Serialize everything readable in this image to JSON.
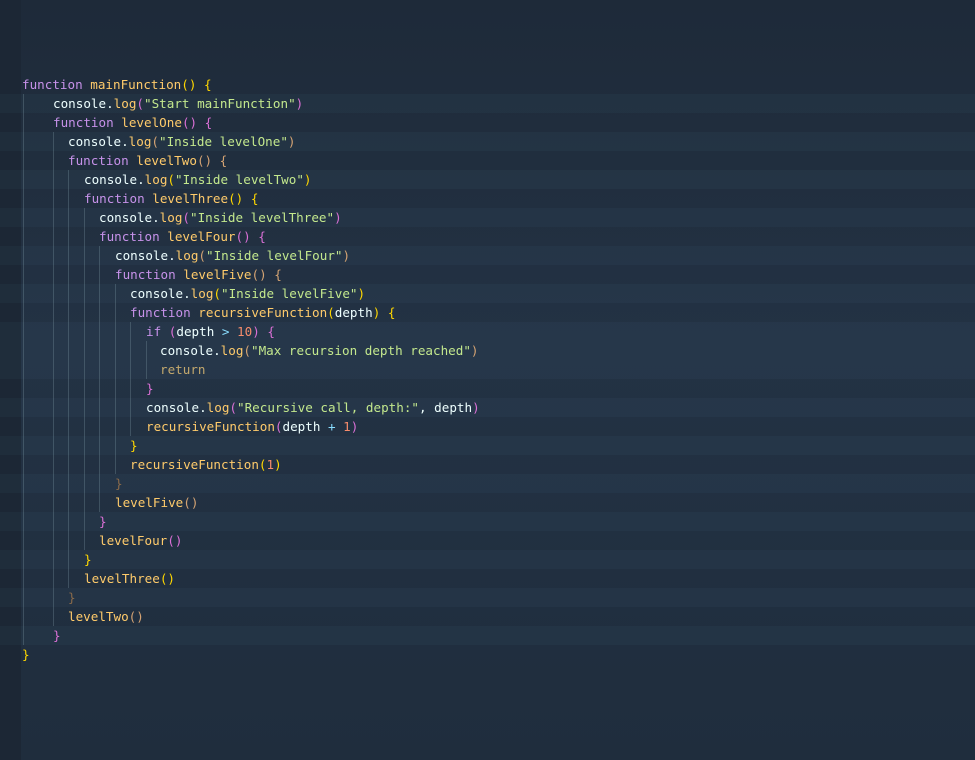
{
  "editor": {
    "lines": [
      [
        {
          "t": "function",
          "c": "kw"
        },
        {
          "t": " ",
          "c": "id"
        },
        {
          "t": "mainFunction",
          "c": "fn"
        },
        {
          "t": "() {",
          "c": "p1"
        }
      ],
      [
        {
          "t": "console",
          "c": "id"
        },
        {
          "t": ".",
          "c": "id"
        },
        {
          "t": "log",
          "c": "fn"
        },
        {
          "t": "(",
          "c": "p2"
        },
        {
          "t": "\"Start mainFunction\"",
          "c": "str"
        },
        {
          "t": ")",
          "c": "p2"
        }
      ],
      [
        {
          "t": "function",
          "c": "kw"
        },
        {
          "t": " ",
          "c": "id"
        },
        {
          "t": "levelOne",
          "c": "fn"
        },
        {
          "t": "() {",
          "c": "p2"
        }
      ],
      [
        {
          "t": "console",
          "c": "id"
        },
        {
          "t": ".",
          "c": "id"
        },
        {
          "t": "log",
          "c": "fn"
        },
        {
          "t": "(",
          "c": "p3"
        },
        {
          "t": "\"Inside levelOne\"",
          "c": "str"
        },
        {
          "t": ")",
          "c": "p3"
        }
      ],
      [
        {
          "t": "function",
          "c": "kw"
        },
        {
          "t": " ",
          "c": "id"
        },
        {
          "t": "levelTwo",
          "c": "fn"
        },
        {
          "t": "() {",
          "c": "p3"
        }
      ],
      [
        {
          "t": "console",
          "c": "id"
        },
        {
          "t": ".",
          "c": "id"
        },
        {
          "t": "log",
          "c": "fn"
        },
        {
          "t": "(",
          "c": "p1"
        },
        {
          "t": "\"Inside levelTwo\"",
          "c": "str"
        },
        {
          "t": ")",
          "c": "p1"
        }
      ],
      [
        {
          "t": "function",
          "c": "kw"
        },
        {
          "t": " ",
          "c": "id"
        },
        {
          "t": "levelThree",
          "c": "fn"
        },
        {
          "t": "() {",
          "c": "p1"
        }
      ],
      [
        {
          "t": "console",
          "c": "id"
        },
        {
          "t": ".",
          "c": "id"
        },
        {
          "t": "log",
          "c": "fn"
        },
        {
          "t": "(",
          "c": "p2"
        },
        {
          "t": "\"Inside levelThree\"",
          "c": "str"
        },
        {
          "t": ")",
          "c": "p2"
        }
      ],
      [
        {
          "t": "function",
          "c": "kw"
        },
        {
          "t": " ",
          "c": "id"
        },
        {
          "t": "levelFour",
          "c": "fn"
        },
        {
          "t": "() {",
          "c": "p2"
        }
      ],
      [
        {
          "t": "console",
          "c": "id"
        },
        {
          "t": ".",
          "c": "id"
        },
        {
          "t": "log",
          "c": "fn"
        },
        {
          "t": "(",
          "c": "p3"
        },
        {
          "t": "\"Inside levelFour\"",
          "c": "str"
        },
        {
          "t": ")",
          "c": "p3"
        }
      ],
      [
        {
          "t": "function",
          "c": "kw"
        },
        {
          "t": " ",
          "c": "id"
        },
        {
          "t": "levelFive",
          "c": "fn"
        },
        {
          "t": "() {",
          "c": "p3"
        }
      ],
      [
        {
          "t": "console",
          "c": "id"
        },
        {
          "t": ".",
          "c": "id"
        },
        {
          "t": "log",
          "c": "fn"
        },
        {
          "t": "(",
          "c": "p1"
        },
        {
          "t": "\"Inside levelFive\"",
          "c": "str"
        },
        {
          "t": ")",
          "c": "p1"
        }
      ],
      [
        {
          "t": "function",
          "c": "kw"
        },
        {
          "t": " ",
          "c": "id"
        },
        {
          "t": "recursiveFunction",
          "c": "fn"
        },
        {
          "t": "(",
          "c": "p1"
        },
        {
          "t": "depth",
          "c": "id"
        },
        {
          "t": ") {",
          "c": "p1"
        }
      ],
      [
        {
          "t": "if",
          "c": "kw"
        },
        {
          "t": " ",
          "c": "id"
        },
        {
          "t": "(",
          "c": "p2"
        },
        {
          "t": "depth",
          "c": "id"
        },
        {
          "t": " > ",
          "c": "op"
        },
        {
          "t": "10",
          "c": "num"
        },
        {
          "t": ") {",
          "c": "p2"
        }
      ],
      [
        {
          "t": "console",
          "c": "id"
        },
        {
          "t": ".",
          "c": "id"
        },
        {
          "t": "log",
          "c": "fn"
        },
        {
          "t": "(",
          "c": "p3"
        },
        {
          "t": "\"Max recursion depth reached\"",
          "c": "str"
        },
        {
          "t": ")",
          "c": "p3"
        }
      ],
      [
        {
          "t": "return",
          "c": "ret"
        }
      ],
      [
        {
          "t": "}",
          "c": "p2"
        }
      ],
      [
        {
          "t": "console",
          "c": "id"
        },
        {
          "t": ".",
          "c": "id"
        },
        {
          "t": "log",
          "c": "fn"
        },
        {
          "t": "(",
          "c": "p2"
        },
        {
          "t": "\"Recursive call, depth:\"",
          "c": "str"
        },
        {
          "t": ", ",
          "c": "id"
        },
        {
          "t": "depth",
          "c": "id"
        },
        {
          "t": ")",
          "c": "p2"
        }
      ],
      [
        {
          "t": "recursiveFunction",
          "c": "fn"
        },
        {
          "t": "(",
          "c": "p2"
        },
        {
          "t": "depth",
          "c": "id"
        },
        {
          "t": " + ",
          "c": "op"
        },
        {
          "t": "1",
          "c": "num"
        },
        {
          "t": ")",
          "c": "p2"
        }
      ],
      [
        {
          "t": "}",
          "c": "p1"
        }
      ],
      [
        {
          "t": "recursiveFunction",
          "c": "fn"
        },
        {
          "t": "(",
          "c": "p1"
        },
        {
          "t": "1",
          "c": "num"
        },
        {
          "t": ")",
          "c": "p1"
        }
      ],
      [
        {
          "t": "}",
          "c": "p4"
        }
      ],
      [
        {
          "t": "levelFive",
          "c": "fn"
        },
        {
          "t": "()",
          "c": "p3"
        }
      ],
      [
        {
          "t": "}",
          "c": "p2"
        }
      ],
      [
        {
          "t": "levelFour",
          "c": "fn"
        },
        {
          "t": "()",
          "c": "p2"
        }
      ],
      [
        {
          "t": "}",
          "c": "p1"
        }
      ],
      [
        {
          "t": "levelThree",
          "c": "fn"
        },
        {
          "t": "()",
          "c": "p1"
        }
      ],
      [
        {
          "t": "}",
          "c": "p4"
        }
      ],
      [
        {
          "t": "levelTwo",
          "c": "fn"
        },
        {
          "t": "()",
          "c": "p3"
        }
      ],
      [
        {
          "t": "}",
          "c": "p2"
        }
      ],
      [
        {
          "t": "}",
          "c": "p1"
        }
      ]
    ]
  }
}
